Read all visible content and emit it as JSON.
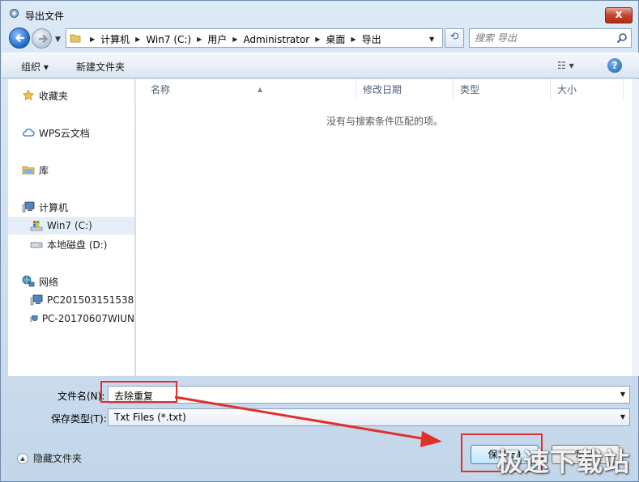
{
  "window": {
    "title": "导出文件",
    "close_label": "x"
  },
  "address_bar": {
    "crumbs": [
      "计算机",
      "Win7 (C:)",
      "用户",
      "Administrator",
      "桌面",
      "导出"
    ],
    "search_placeholder": "搜索 导出"
  },
  "toolbar": {
    "organize": "组织 ▾",
    "new_folder": "新建文件夹",
    "view": "☷ ▾",
    "help": "?"
  },
  "nav": {
    "favorites": "收藏夹",
    "wps_cloud": "WPS云文档",
    "libraries": "库",
    "computer": "计算机",
    "drive_c": "Win7 (C:)",
    "drive_d": "本地磁盘 (D:)",
    "network": "网络",
    "pc1": "PC201503151538",
    "pc2": "PC-20170607WIUN"
  },
  "file_list": {
    "columns": [
      "名称",
      "修改日期",
      "类型",
      "大小"
    ],
    "empty_message": "没有与搜索条件匹配的项。"
  },
  "form": {
    "filename_label": "文件名(N):",
    "filename_value": "去除重复",
    "filetype_label": "保存类型(T):",
    "filetype_value": "Txt Files (*.txt)"
  },
  "footer": {
    "hide_folders": "隐藏文件夹",
    "save_button": "保存(S)",
    "cancel_button": "取消"
  },
  "watermark": "极速下载站",
  "colors": {
    "annotation_red": "#e0302b",
    "window_frame": "#c3d6ea"
  }
}
